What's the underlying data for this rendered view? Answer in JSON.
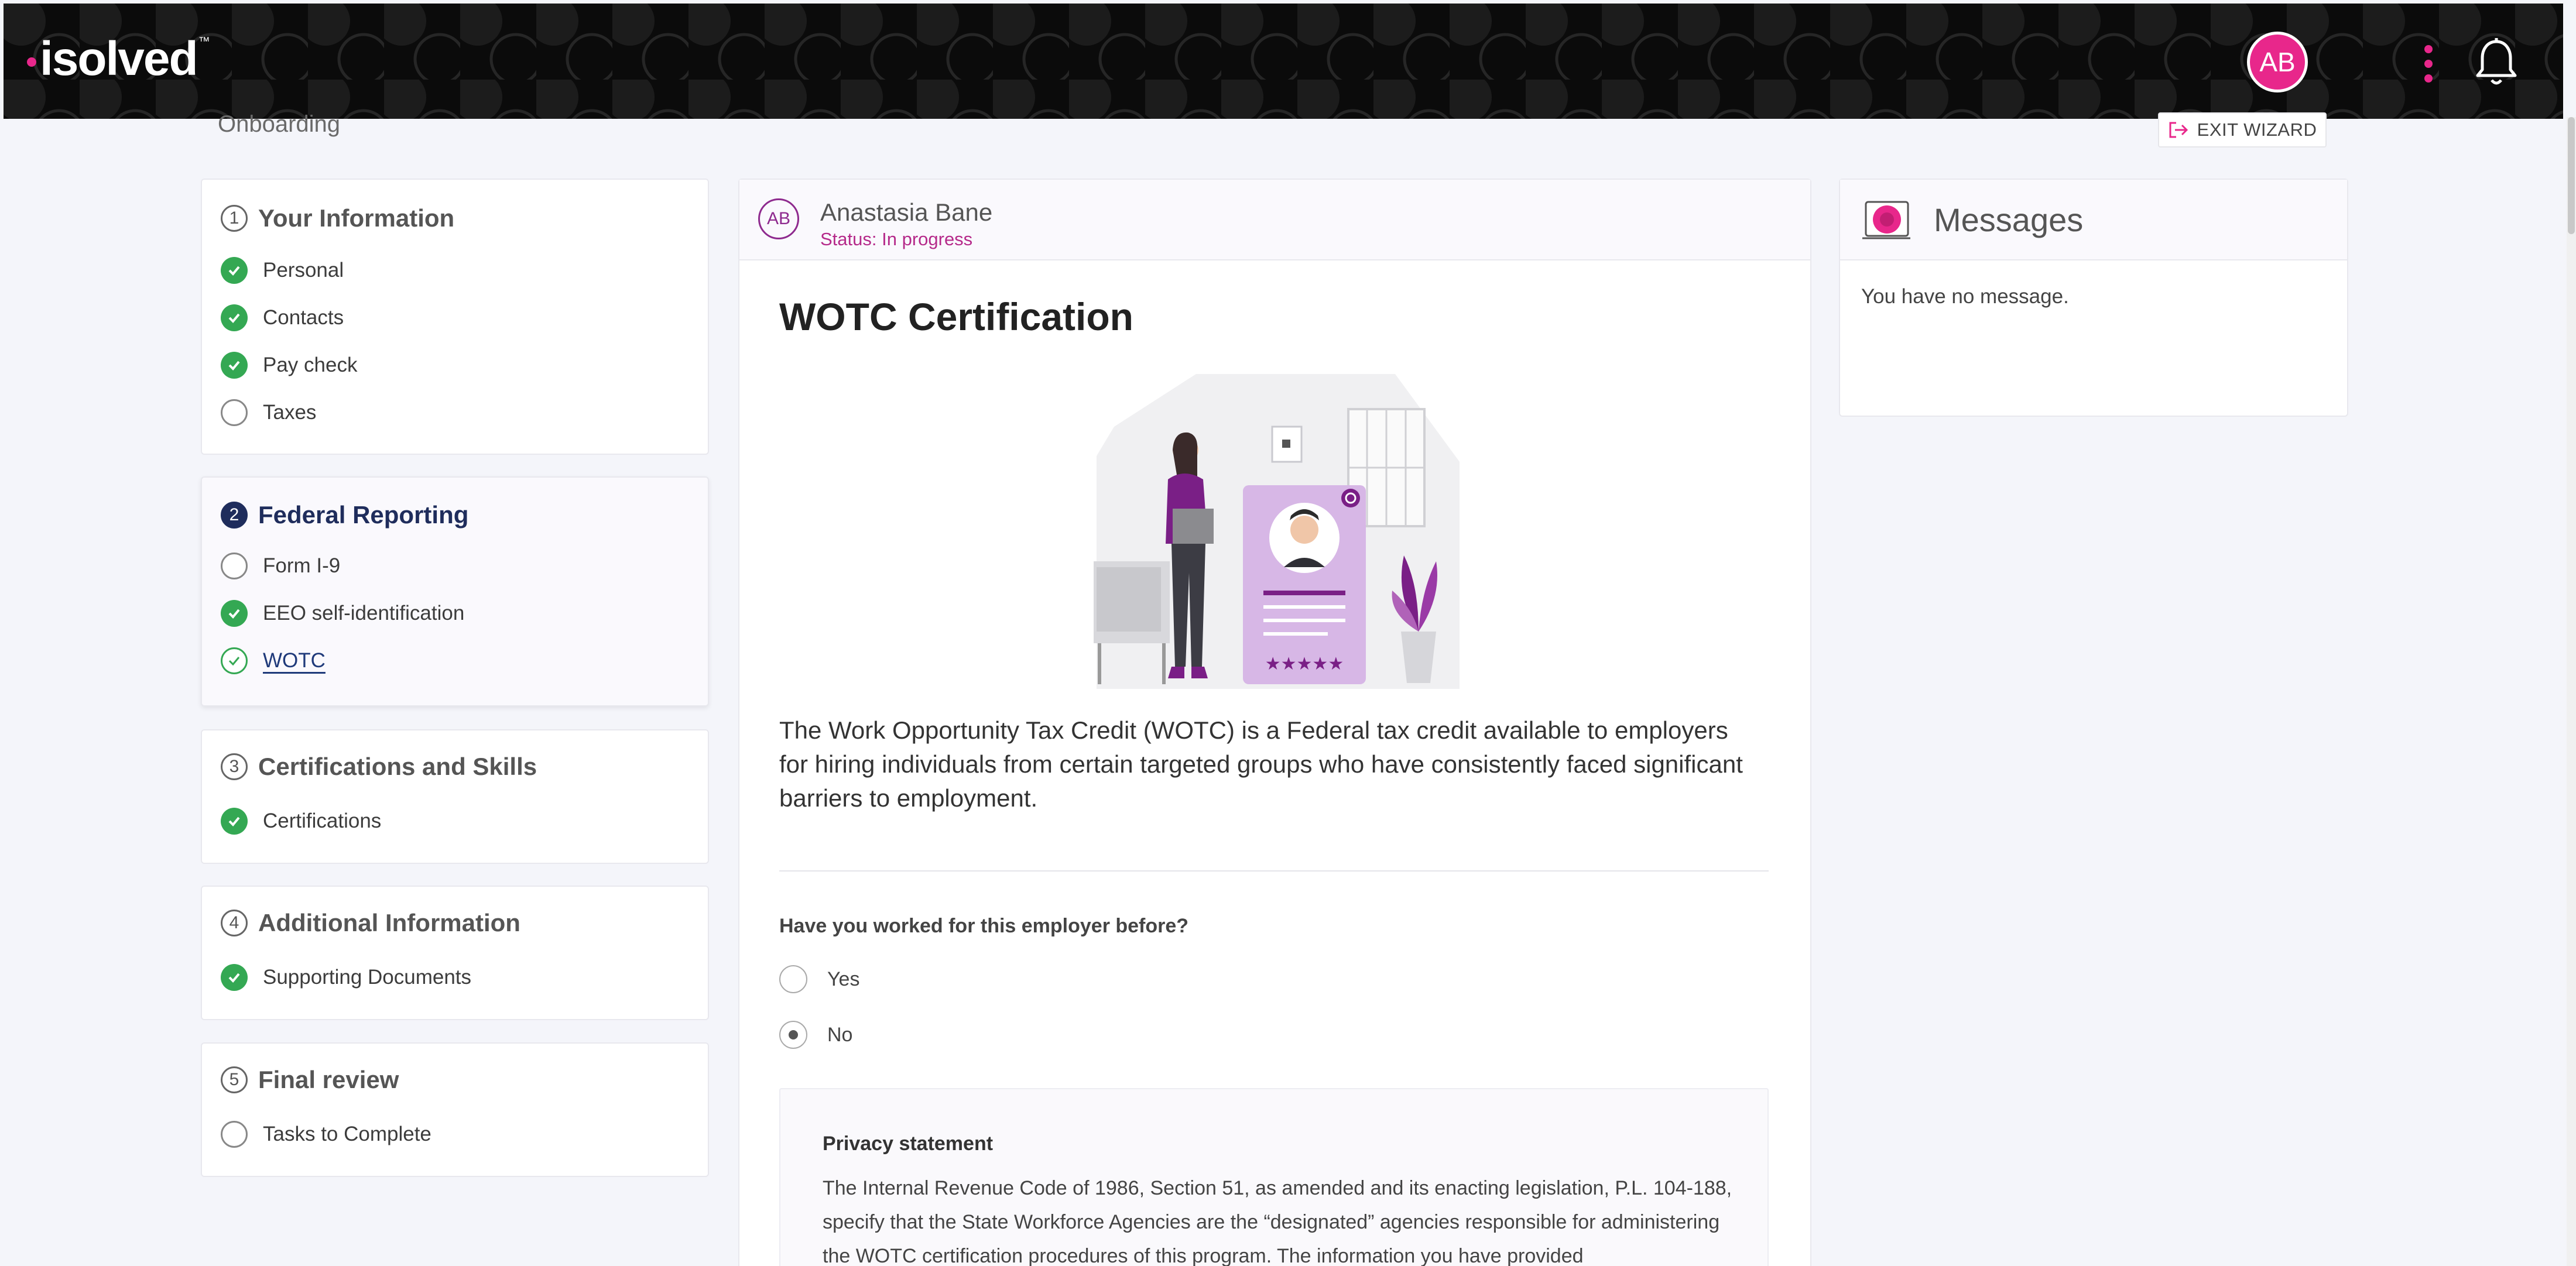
{
  "header": {
    "logo_text": "isolved",
    "logo_tm": "™",
    "user_initials": "AB",
    "brand_color": "#e8278b"
  },
  "page": {
    "title": "Onboarding",
    "exit_label": "EXIT WIZARD"
  },
  "steps": [
    {
      "number": "1",
      "title": "Your Information",
      "items": [
        {
          "label": "Personal",
          "state": "done"
        },
        {
          "label": "Contacts",
          "state": "done"
        },
        {
          "label": "Pay check",
          "state": "done"
        },
        {
          "label": "Taxes",
          "state": "todo"
        }
      ]
    },
    {
      "number": "2",
      "title": "Federal Reporting",
      "items": [
        {
          "label": "Form I-9",
          "state": "todo"
        },
        {
          "label": "EEO self-identification",
          "state": "done"
        },
        {
          "label": "WOTC",
          "state": "current"
        }
      ]
    },
    {
      "number": "3",
      "title": "Certifications and Skills",
      "items": [
        {
          "label": "Certifications",
          "state": "done"
        }
      ]
    },
    {
      "number": "4",
      "title": "Additional Information",
      "items": [
        {
          "label": "Supporting Documents",
          "state": "done"
        }
      ]
    },
    {
      "number": "5",
      "title": "Final review",
      "items": [
        {
          "label": "Tasks to Complete",
          "state": "todo"
        }
      ]
    }
  ],
  "employee": {
    "initials": "AB",
    "name": "Anastasia Bane",
    "status": "Status: In progress"
  },
  "main": {
    "title": "WOTC Certification",
    "description": "The Work Opportunity Tax Credit (WOTC) is a Federal tax credit available to employers for hiring individuals from certain targeted groups who have consistently faced significant barriers to employment.",
    "question": "Have you worked for this employer before?",
    "options": [
      {
        "label": "Yes",
        "selected": false
      },
      {
        "label": "No",
        "selected": true
      }
    ],
    "privacy_title": "Privacy statement",
    "privacy_text": "The Internal Revenue Code of 1986, Section 51, as amended and its enacting legislation, P.L. 104-188, specify that the State Workforce Agencies are the “designated” agencies responsible for administering the WOTC certification procedures of this program. The information you have provided"
  },
  "messages": {
    "title": "Messages",
    "empty_text": "You have no message."
  }
}
